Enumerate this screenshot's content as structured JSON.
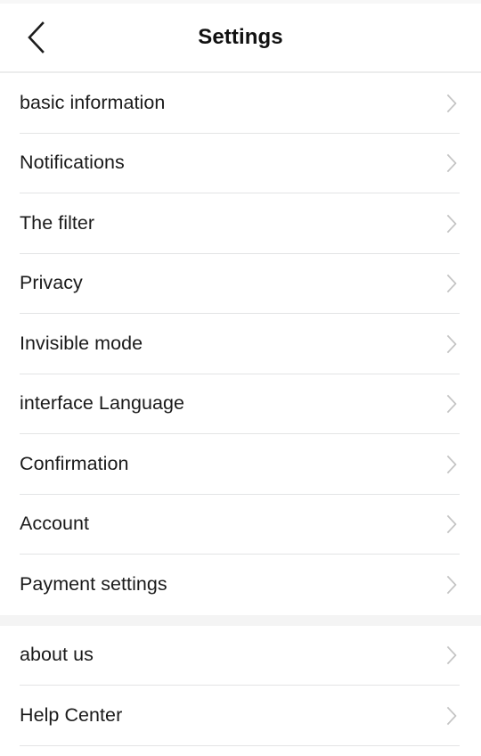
{
  "header": {
    "title": "Settings",
    "back_icon": "chevron-left-icon"
  },
  "list": {
    "chevron_icon": "chevron-right-icon",
    "groups": [
      {
        "name": "primary-settings-group",
        "items": [
          {
            "label": "basic information"
          },
          {
            "label": "Notifications"
          },
          {
            "label": "The filter"
          },
          {
            "label": "Privacy"
          },
          {
            "label": "Invisible mode"
          },
          {
            "label": "interface Language"
          },
          {
            "label": "Confirmation"
          },
          {
            "label": "Account"
          },
          {
            "label": "Payment settings"
          }
        ]
      },
      {
        "name": "support-group",
        "items": [
          {
            "label": "about us"
          },
          {
            "label": "Help Center"
          }
        ]
      }
    ]
  },
  "colors": {
    "background": "#ffffff",
    "separator": "#f4f4f4",
    "divider": "#e3e4e5",
    "text": "#1a1a1a",
    "title": "#111111",
    "chevron": "#c4c4c4"
  }
}
